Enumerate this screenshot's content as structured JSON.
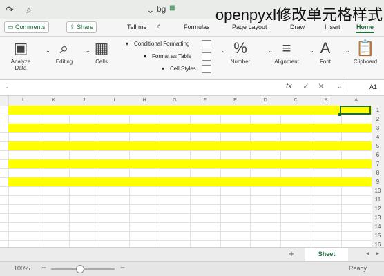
{
  "overlay_caption": "openpyxl修改单元格样式",
  "window": {
    "file_name": "bg"
  },
  "toolbar": {
    "comments_label": "Comments",
    "share_label": "Share",
    "tell_me_label": "Tell me"
  },
  "ribbon_tabs": [
    {
      "label": "Formulas"
    },
    {
      "label": "Page Layout"
    },
    {
      "label": "Draw"
    },
    {
      "label": "Insert"
    },
    {
      "label": "Home"
    }
  ],
  "ribbon": {
    "analyze_data_line1": "Analyze",
    "analyze_data_line2": "Data",
    "editing_label": "Editing",
    "cells_label": "Cells",
    "conditional_formatting_label": "Conditional Formatting",
    "format_as_table_label": "Format as Table",
    "cell_styles_label": "Cell Styles",
    "number_label": "Number",
    "alignment_label": "Alignment",
    "font_label": "Font",
    "clipboard_label": "Clipboard"
  },
  "formula_bar": {
    "name_box": "A1",
    "fx_label": "fx"
  },
  "grid": {
    "columns": [
      "L",
      "K",
      "J",
      "I",
      "H",
      "G",
      "F",
      "E",
      "D",
      "C",
      "B",
      "A"
    ],
    "rows": [
      "1",
      "2",
      "3",
      "4",
      "5",
      "6",
      "7",
      "8",
      "9",
      "10",
      "11",
      "12",
      "13",
      "14",
      "15",
      "16"
    ],
    "highlight_color": "#ffff00"
  },
  "sheet_tabs": {
    "active_sheet": "Sheet",
    "add_label": "+"
  },
  "status": {
    "ready_label": "Ready",
    "zoom_label": "100%",
    "plus_label": "+",
    "minus_label": "−"
  }
}
